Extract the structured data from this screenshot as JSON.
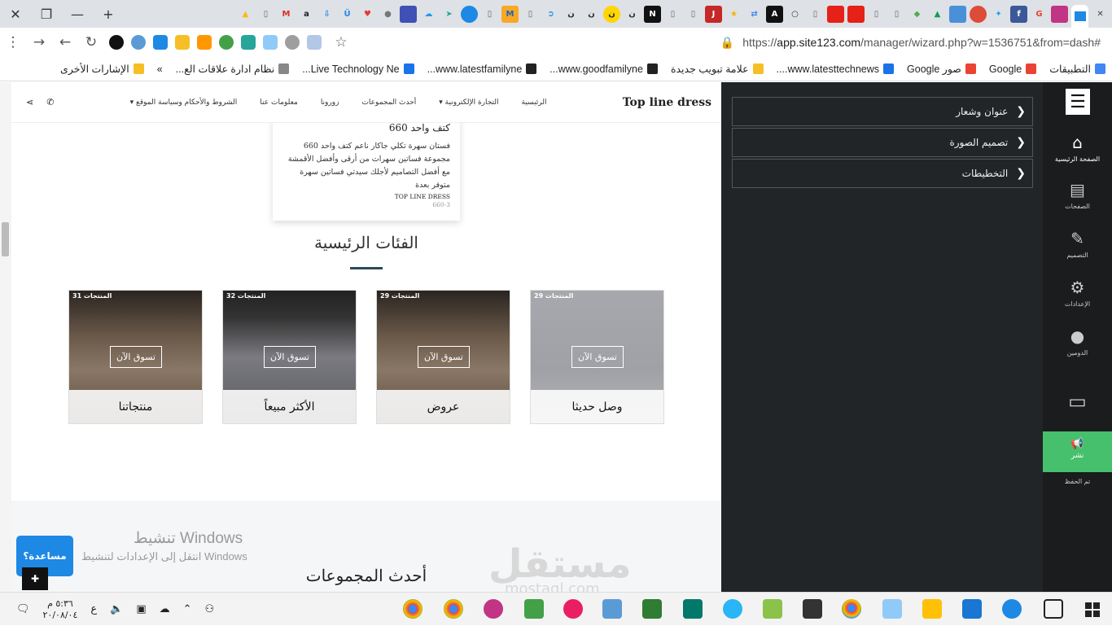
{
  "browser": {
    "url_prefix": "https://",
    "url_host": "app.site123.com",
    "url_path": "/manager/wizard.php?w=1536751&from=dash#",
    "bookmarks": [
      {
        "label": "التطبيقات",
        "icon": "apps-grid-icon",
        "color": "#4285f4"
      },
      {
        "label": "Google",
        "icon": "google-icon",
        "color": "#ea4335"
      },
      {
        "label": "صور Google",
        "icon": "google-icon",
        "color": "#ea4335"
      },
      {
        "label": "www.latesttechnews....",
        "icon": "globe-icon",
        "color": "#1a73e8"
      },
      {
        "label": "علامة تبويب جديدة",
        "icon": "page-icon",
        "color": "#f6bf26"
      },
      {
        "label": "www.goodfamilyne...",
        "icon": "id-icon",
        "color": "#222222"
      },
      {
        "label": "www.latestfamilyne...",
        "icon": "id-icon",
        "color": "#222222"
      },
      {
        "label": "Live Technology Ne...",
        "icon": "globe-icon",
        "color": "#1a73e8"
      },
      {
        "label": "نظام ادارة علاقات الع...",
        "icon": "page-icon",
        "color": "#888888"
      },
      {
        "label": "»",
        "icon": "chevron-more-icon",
        "color": "#555555"
      },
      {
        "label": "الإشارات الأخرى",
        "icon": "folder-icon",
        "color": "#f6bf26"
      }
    ]
  },
  "site": {
    "brand": "Top line dress",
    "nav": [
      "الرئيسية",
      "التجارة الإلكترونية ▾",
      "أحدث المجموعات",
      "زورونا",
      "معلومات عنا",
      "الشروط والأحكام وسياسة الموقع ▾"
    ],
    "product_card": {
      "title": "كتف واحد 660",
      "description": "فستان سهرة تكلي جاكار ناعم كتف واحد 660 مجموعة فساتين سهرات من أرقى وأفضل الأقمشة مع أفضل التصاميم لأجلك سيدتي فساتين سهرة متوفر بعدة",
      "brand": "TOP LINE DRESS",
      "code": "660-3"
    },
    "categories_title": "الفئات الرئيسية",
    "categories": [
      {
        "label": "وصل حديثا",
        "count": "29 المنتجات",
        "shop": "تسوق الآن",
        "theme": "grey"
      },
      {
        "label": "عروض",
        "count": "29 المنتجات",
        "shop": "تسوق الآن",
        "theme": "store"
      },
      {
        "label": "الأكثر مبيعاً",
        "count": "32 المنتجات",
        "shop": "تسوق الآن",
        "theme": "storefront"
      },
      {
        "label": "منتجاتنا",
        "count": "31 المنتجات",
        "shop": "تسوق الآن",
        "theme": "store"
      }
    ],
    "latest_title": "أحدث المجموعات",
    "help_button": "مساعدة؟"
  },
  "windows_watermark": {
    "title": "تنشيط Windows",
    "subtitle": "انتقل إلى الإعدادات لتنشيط Windows"
  },
  "brand_watermark": {
    "main": "مستقل",
    "sub": "mostaql.com"
  },
  "editor": {
    "panels": [
      "عنوان وشعار",
      "تصميم الصورة",
      "التخطيطات"
    ]
  },
  "rail": {
    "items": [
      {
        "label": "الصفحة الرئيسية",
        "icon": "home-icon"
      },
      {
        "label": "الصفحات",
        "icon": "pages-icon"
      },
      {
        "label": "التصميم",
        "icon": "brush-icon"
      },
      {
        "label": "الإعدادات",
        "icon": "gear-icon"
      },
      {
        "label": "الدومين",
        "icon": "globe-icon"
      }
    ],
    "publish": "نشر",
    "saved": "تم الحفظ"
  },
  "taskbar": {
    "time": "٥:٣٦ م",
    "date": "٢٠/٠٨/٠٤",
    "lang": "ع"
  }
}
